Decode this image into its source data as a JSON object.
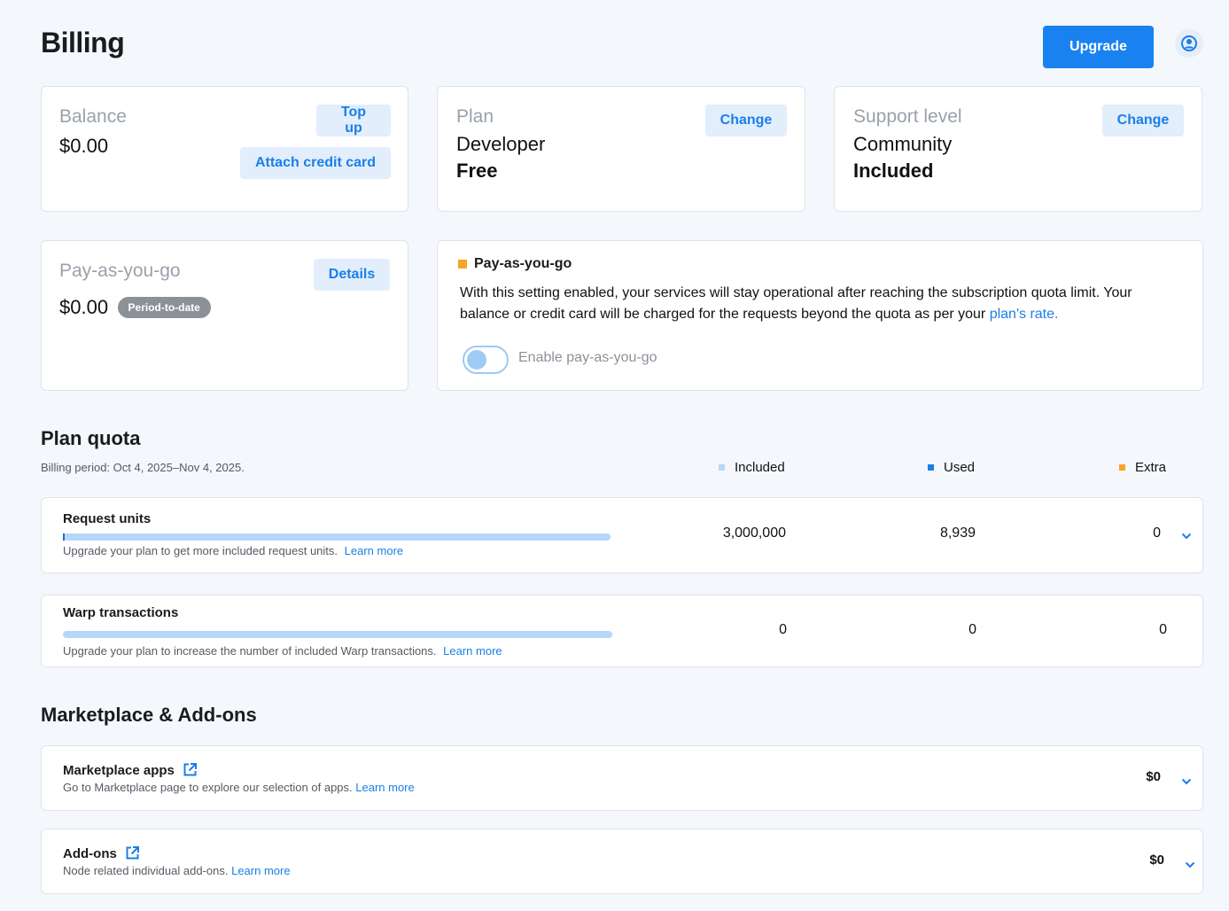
{
  "header": {
    "title": "Billing",
    "upgrade_label": "Upgrade",
    "account_icon": "user-circle-icon"
  },
  "cards": {
    "balance": {
      "label": "Balance",
      "value": "$0.00",
      "topup_label": "Top up",
      "attach_label": "Attach credit card"
    },
    "plan": {
      "label": "Plan",
      "name": "Developer",
      "price": "Free",
      "change_label": "Change"
    },
    "support": {
      "label": "Support level",
      "name": "Community",
      "price": "Included",
      "change_label": "Change"
    },
    "payg": {
      "label": "Pay-as-you-go",
      "value": "$0.00",
      "badge": "Period-to-date",
      "details_label": "Details"
    }
  },
  "payg_info": {
    "title": "Pay-as-you-go",
    "text": "With this setting enabled, your services will stay operational after reaching the subscription quota limit. Your balance or credit card will be charged for the requests beyond the quota as per your ",
    "link": "plan's rate.",
    "toggle_label": "Enable pay-as-you-go",
    "toggle_on": false
  },
  "quota": {
    "title": "Plan quota",
    "period": "Billing period: Oct 4, 2025–Nov 4, 2025.",
    "legend": {
      "included": "Included",
      "used": "Used",
      "extra": "Extra"
    },
    "colors": {
      "included": "#b5d7f8",
      "used": "#1a7fe8",
      "extra": "#f5a623"
    },
    "rows": [
      {
        "title": "Request units",
        "desc": "Upgrade your plan to get more included request units.",
        "link": "Learn more",
        "included": "3,000,000",
        "used": "8,939",
        "extra": "0",
        "used_fraction": 0.003
      },
      {
        "title": "Warp transactions",
        "desc": "Upgrade your plan to increase the number of included Warp transactions.",
        "link": "Learn more",
        "included": "0",
        "used": "0",
        "extra": "0",
        "used_fraction": 0
      }
    ]
  },
  "marketplace": {
    "title": "Marketplace & Add-ons",
    "rows": [
      {
        "title": "Marketplace apps",
        "desc": "Go to Marketplace page to explore our selection of apps.",
        "link": "Learn more",
        "amount": "$0"
      },
      {
        "title": "Add-ons",
        "desc": "Node related individual add-ons.",
        "link": "Learn more",
        "amount": "$0"
      }
    ]
  }
}
